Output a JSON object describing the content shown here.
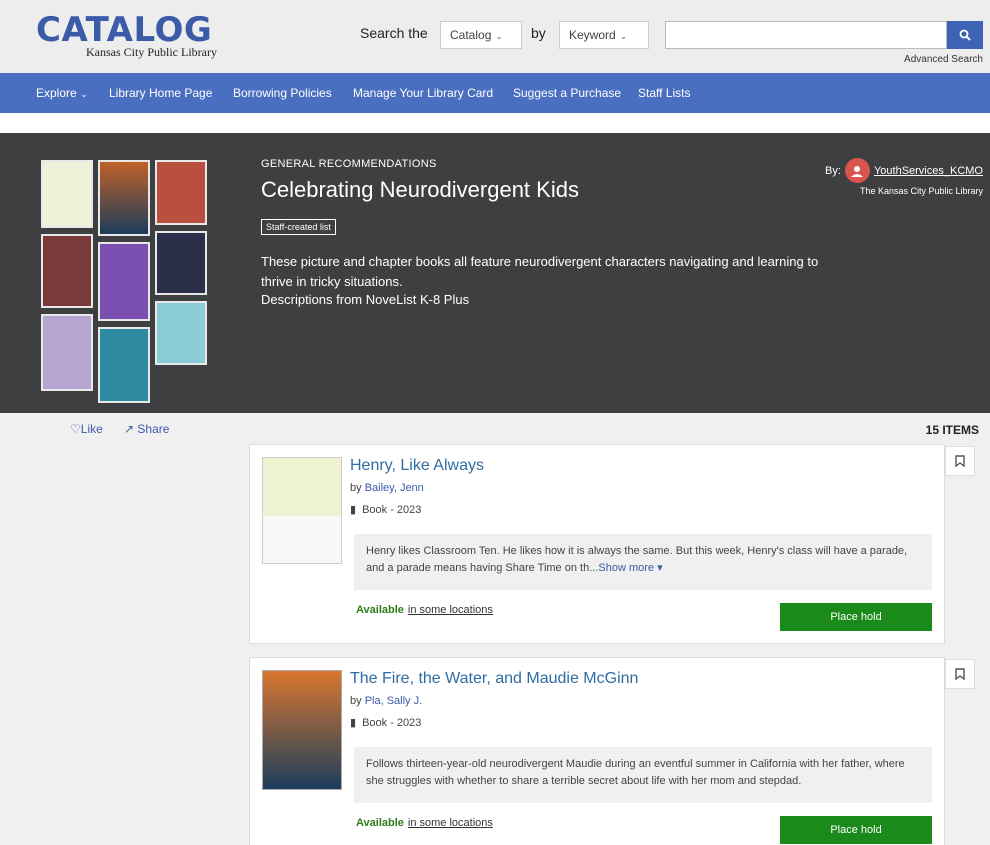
{
  "header": {
    "logo_text": "CATALOG",
    "logo_sub": "Kansas City Public Library",
    "search_label": "Search the",
    "scope_select": "Catalog",
    "by_label": "by",
    "field_select": "Keyword",
    "search_placeholder": "",
    "advanced_search": "Advanced Search"
  },
  "nav": [
    {
      "label": "Explore"
    },
    {
      "label": "Library Home Page"
    },
    {
      "label": "Borrowing Policies"
    },
    {
      "label": "Manage Your Library Card"
    },
    {
      "label": "Suggest a Purchase"
    },
    {
      "label": "Staff Lists"
    }
  ],
  "list": {
    "category": "GENERAL RECOMMENDATIONS",
    "title": "Celebrating Neurodivergent Kids",
    "badge": "Staff-created list",
    "description": "These picture and chapter books all feature neurodivergent characters navigating and learning to thrive in tricky situations.",
    "source": "Descriptions from NoveList K-8 Plus",
    "by_label": "By:",
    "creator": "YouthServices_KCMO",
    "organization": "The Kansas City Public Library",
    "like_label": "Like",
    "share_label": "Share",
    "item_count": "15 ITEMS"
  },
  "items": [
    {
      "title": "Henry, Like Always",
      "by": "by",
      "author": "Bailey, Jenn",
      "format": "Book - 2023",
      "blurb": "Henry likes Classroom Ten. He likes how it is always the same. But this week, Henry's class will have a parade, and a parade means having Share Time on th...",
      "show_more": "Show more",
      "availability": "Available",
      "locations": "in some locations",
      "hold": "Place hold"
    },
    {
      "title": "The Fire, the Water, and Maudie McGinn",
      "by": "by",
      "author": "Pla, Sally J.",
      "format": "Book - 2023",
      "blurb": "Follows thirteen-year-old neurodivergent Maudie during an eventful summer in California with her father, where she struggles with whether to share a terrible secret about life with her mom and stepdad.",
      "availability": "Available",
      "locations": "in some locations",
      "hold": "Place hold"
    }
  ],
  "colors": {
    "brand_blue": "#3b5aa8",
    "nav_blue": "#4a6fc0",
    "hero_bg": "#3d3f41",
    "hold_green": "#1a8a1a",
    "available_green": "#2e7d1a"
  }
}
